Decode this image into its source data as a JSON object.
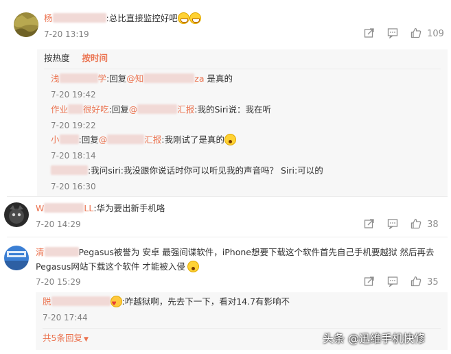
{
  "comments": [
    {
      "username_prefix": "杨",
      "text": ":总比直接监控好吧",
      "time": "7-20 13:19",
      "likes": "109",
      "sort_tabs": [
        "按热度",
        "按时间"
      ],
      "active_sort": "按时间",
      "replies": [
        {
          "username_prefix": "浅",
          "username_suffix": "学",
          "text_prefix": ":回复",
          "mention_prefix": "@知",
          "mention_suffix": "za",
          "text": " 是真的",
          "time": "7-20 19:42"
        },
        {
          "username_prefix": "作业",
          "username_suffix": "很好吃",
          "text_prefix": ":回复",
          "mention_prefix": "@",
          "mention_suffix": "汇报",
          "text": ":我的Siri说：我在听",
          "time": "7-20 19:22"
        },
        {
          "username_prefix": "小",
          "username_suffix": "",
          "text_prefix": ":回复",
          "mention_prefix": "@",
          "mention_suffix": "汇报",
          "text": ":我刚试了是真的",
          "time": "7-20 18:14"
        },
        {
          "username_prefix": "",
          "username_suffix": "",
          "text_prefix": "",
          "mention_prefix": "",
          "mention_suffix": "",
          "text": ":我问siri:我没跟你说话时你可以听见我的声音吗？ Siri:可以的",
          "time": "7-20 16:30"
        }
      ]
    },
    {
      "username_prefix": "W",
      "username_suffix": "LL",
      "text": ":华为要出新手机咯",
      "time": "7-20 14:29",
      "likes": "38"
    },
    {
      "username_prefix": "清",
      "text_line1": "Pegasus被誉为 安卓 最强间谍软件，iPhone想要下载这个软件首先自己手机要越狱 然后再去",
      "text_line2": "Pegasus网站下载这个软件 才能被入侵",
      "time": "7-20 15:29",
      "likes": "35",
      "replies": [
        {
          "username_prefix": "脱",
          "text": ":咋越狱啊，先去下一下，看对14.7有影响不",
          "time": "7-20 17:44"
        }
      ],
      "more_replies": "共5条回复",
      "more_icon": "caret-down-icon"
    }
  ],
  "watermark": "头条 @迅维手机快修",
  "icons": {
    "forward": "forward-icon",
    "comment": "comment-icon",
    "like": "thumbs-up-icon"
  },
  "colors": {
    "accent": "#eb7350",
    "meta": "#808080",
    "reply_bg": "#f7f7f7"
  }
}
